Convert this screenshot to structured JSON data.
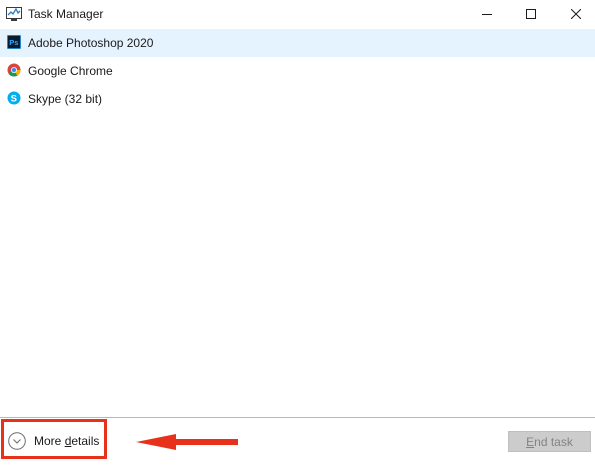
{
  "window": {
    "title": "Task Manager",
    "icon": "task-manager-icon",
    "controls": [
      "minimize",
      "maximize",
      "close"
    ]
  },
  "apps": [
    {
      "name": "Adobe Photoshop 2020",
      "icon": "photoshop-icon",
      "selected": true
    },
    {
      "name": "Google Chrome",
      "icon": "chrome-icon",
      "selected": false
    },
    {
      "name": "Skype (32 bit)",
      "icon": "skype-icon",
      "selected": false
    }
  ],
  "footer": {
    "more_details_prefix": "More ",
    "more_details_accel": "d",
    "more_details_suffix": "etails",
    "end_task_accel": "E",
    "end_task_suffix": "nd task",
    "end_task_enabled": false
  },
  "annotation": {
    "highlight_color": "#e8311a"
  },
  "colors": {
    "selected_row": "#e5f3ff",
    "disabled_button_bg": "#cccccc",
    "disabled_button_text": "#838383"
  }
}
